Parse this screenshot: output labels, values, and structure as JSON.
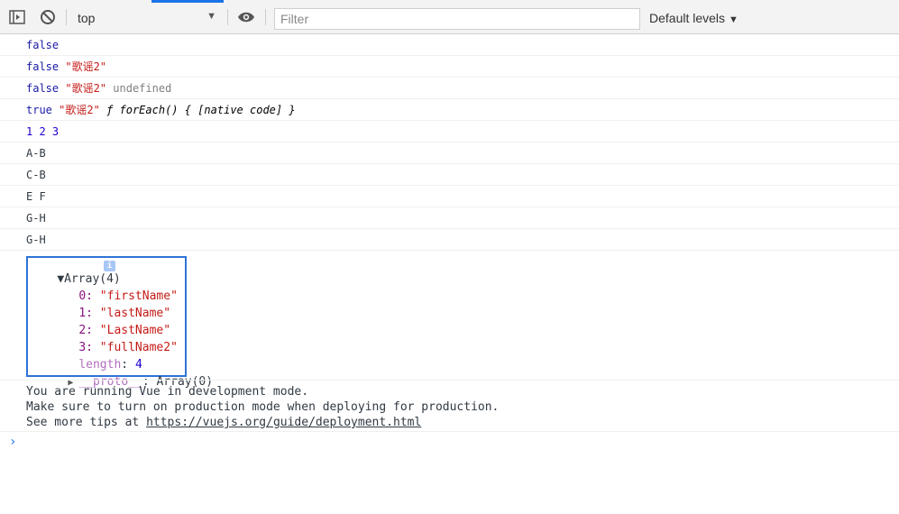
{
  "toolbar": {
    "context": "top",
    "filter_placeholder": "Filter",
    "levels_label": "Default levels"
  },
  "console": {
    "rows": [
      {
        "parts": [
          "false"
        ]
      },
      {
        "parts": [
          "false",
          "\"歌谣2\""
        ]
      },
      {
        "parts": [
          "false",
          "\"歌谣2\"",
          "undefined"
        ]
      },
      {
        "parts": [
          "true",
          "\"歌谣2\"",
          "ƒ forEach() { [native code] }"
        ]
      },
      {
        "parts": [
          "1 2 3"
        ]
      },
      {
        "parts": [
          "A-B"
        ]
      },
      {
        "parts": [
          "C-B"
        ]
      },
      {
        "parts": [
          "E F"
        ]
      },
      {
        "parts": [
          "G-H"
        ]
      },
      {
        "parts": [
          "G-H"
        ]
      }
    ],
    "array": {
      "header": "Array(4)",
      "info": "i",
      "items": [
        {
          "key": "0",
          "value": "\"firstName\""
        },
        {
          "key": "1",
          "value": "\"lastName\""
        },
        {
          "key": "2",
          "value": "\"LastName\""
        },
        {
          "key": "3",
          "value": "\"fullName2\""
        }
      ],
      "length_key": "length",
      "length_value": "4",
      "proto_key": "__proto__",
      "proto_value": "Array(0)"
    },
    "vue": {
      "line1": "You are running Vue in development mode.",
      "line2": "Make sure to turn on production mode when deploying for production.",
      "line3_prefix": "See more tips at ",
      "link": "https://vuejs.org/guide/deployment.html"
    },
    "prompt": "›"
  }
}
